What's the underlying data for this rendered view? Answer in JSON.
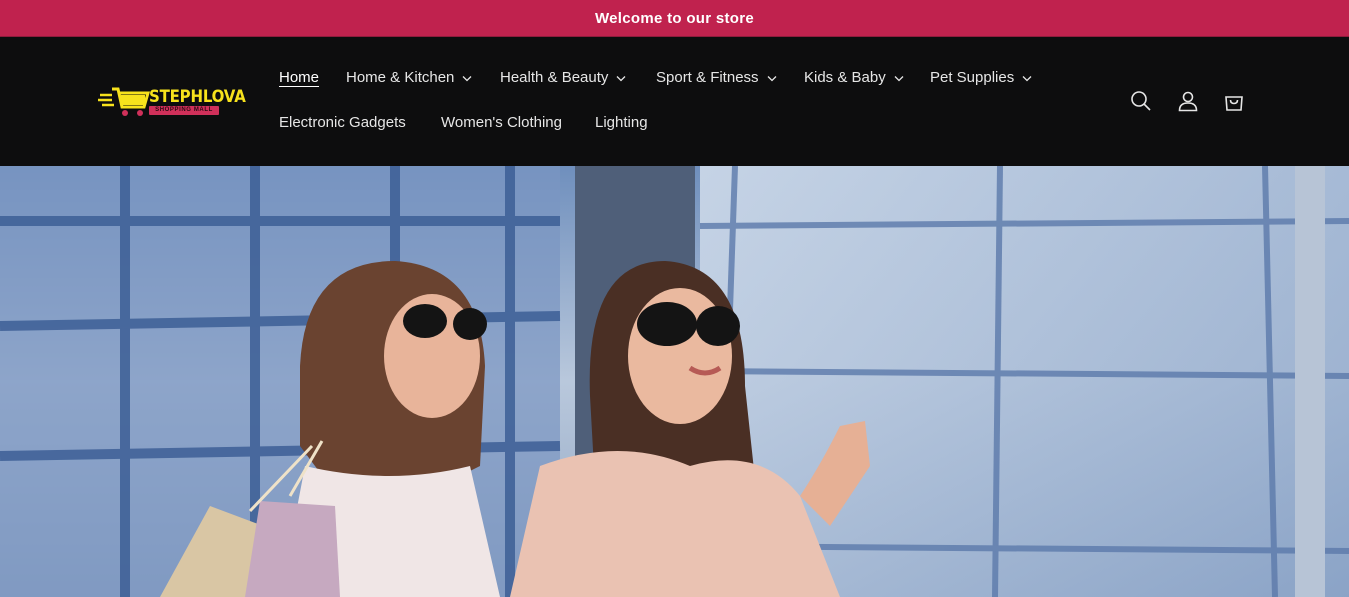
{
  "announcement": {
    "text": "Welcome to our store"
  },
  "logo": {
    "brand": "STEPHLOVA",
    "tagline": "SHOPPING MALL"
  },
  "nav": {
    "items": [
      {
        "label": "Home",
        "active": true,
        "dropdown": false
      },
      {
        "label": "Home & Kitchen",
        "dropdown": true
      },
      {
        "label": "Health & Beauty",
        "dropdown": true
      },
      {
        "label": "Sport & Fitness",
        "dropdown": true
      },
      {
        "label": "Kids & Baby",
        "dropdown": true
      },
      {
        "label": "Pet Supplies",
        "dropdown": true
      },
      {
        "label": "Electronic Gadgets",
        "dropdown": false
      },
      {
        "label": "Women's Clothing",
        "dropdown": false
      },
      {
        "label": "Lighting",
        "dropdown": false
      }
    ]
  },
  "header_icons": [
    "search-icon",
    "account-icon",
    "cart-icon"
  ],
  "hero": {
    "image": "two-women-shopping-with-bags-photo"
  },
  "colors": {
    "announcement_bg": "#c0224e",
    "header_bg": "#0d0d0e",
    "logo_yellow": "#f7e21c",
    "logo_pink": "#d0305a"
  }
}
